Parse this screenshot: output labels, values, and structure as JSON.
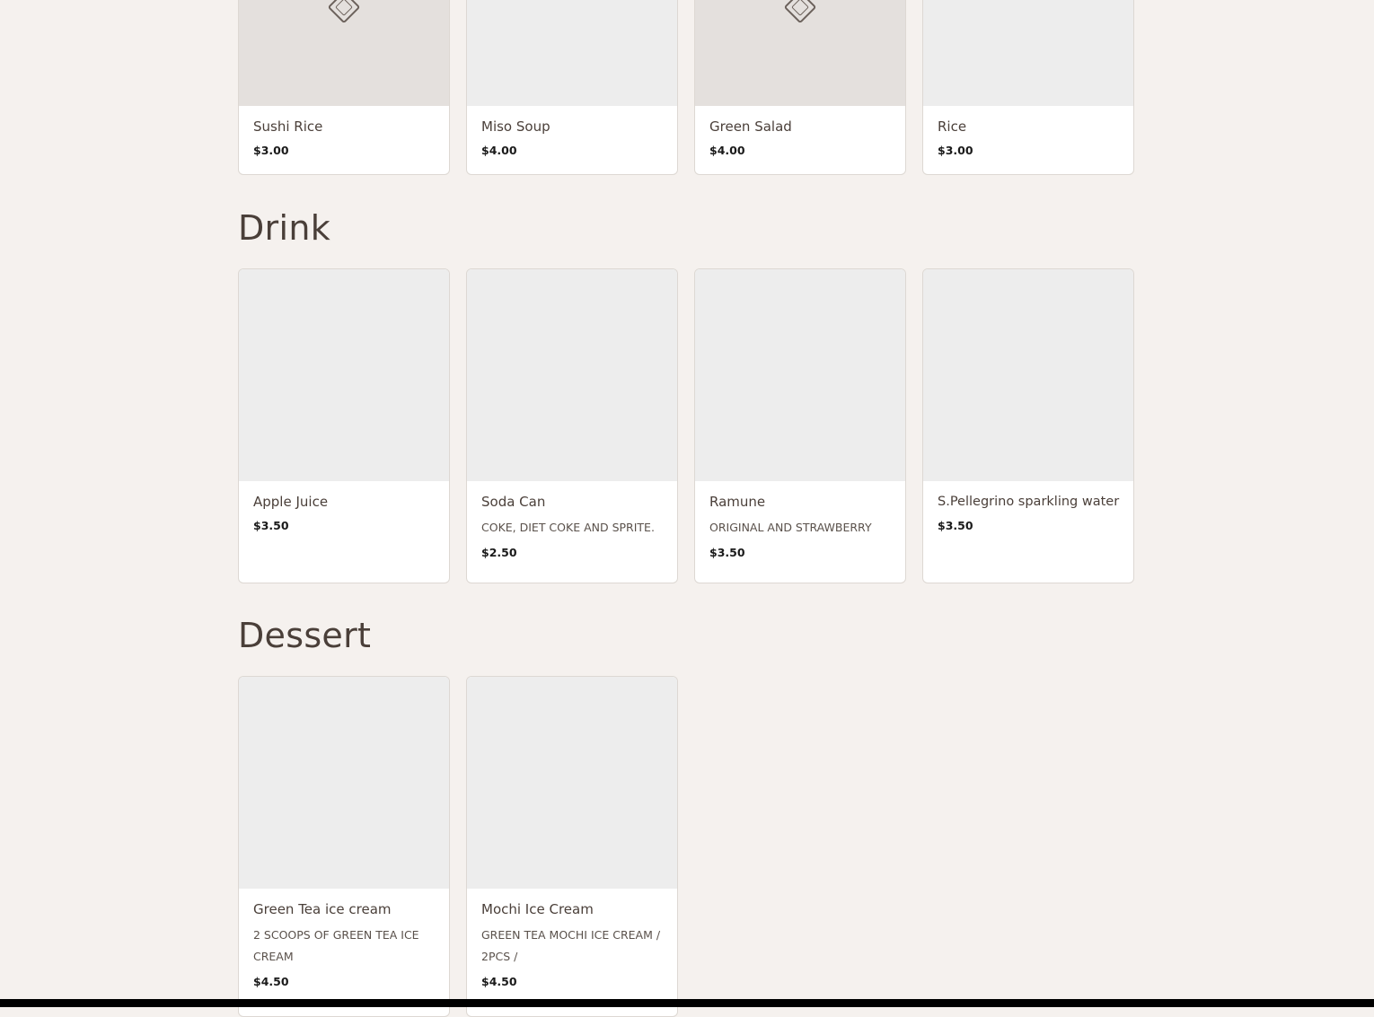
{
  "sections": [
    {
      "title": "",
      "items": [
        {
          "name": "Sushi Rice",
          "description": "",
          "price": "$3.00",
          "image_icon": "tag-icon"
        },
        {
          "name": "Miso Soup",
          "description": "",
          "price": "$4.00",
          "image_icon": ""
        },
        {
          "name": "Green Salad",
          "description": "",
          "price": "$4.00",
          "image_icon": "tag-icon"
        },
        {
          "name": "Rice",
          "description": "",
          "price": "$3.00",
          "image_icon": ""
        }
      ]
    },
    {
      "title": "Drink",
      "items": [
        {
          "name": "Apple Juice",
          "description": "",
          "price": "$3.50"
        },
        {
          "name": "Soda Can",
          "description": "Coke, Diet coke and Sprite.",
          "price": "$2.50"
        },
        {
          "name": "Ramune",
          "description": "Original and strawberry",
          "price": "$3.50"
        },
        {
          "name": "S.Pellegrino sparkling water",
          "description": "",
          "price": "$3.50"
        }
      ]
    },
    {
      "title": "Dessert",
      "items": [
        {
          "name": "Green Tea ice cream",
          "description": "2 scoops of green tea ice cream",
          "price": "$4.50"
        },
        {
          "name": "Mochi Ice Cream",
          "description": "Green tea mochi ice cream / 2pcs /",
          "price": "$4.50"
        }
      ]
    }
  ],
  "colors": {
    "page_background": "#f5f1ee",
    "card_background": "#ffffff",
    "image_placeholder": "#ededed",
    "heading_text": "#4a3f39"
  }
}
